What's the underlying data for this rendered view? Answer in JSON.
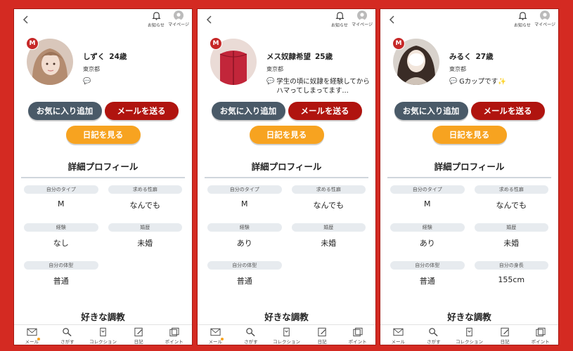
{
  "nav": {
    "notice_label": "お知らせ",
    "mypage_label": "マイページ"
  },
  "buttons": {
    "favorite": "お気に入り追加",
    "mail": "メールを送る",
    "diary": "日記を見る"
  },
  "sections": {
    "detail": "詳細プロフィール",
    "favorite_training": "好きな調教"
  },
  "tabs": {
    "mail": "メール",
    "search": "さがす",
    "collection": "コレクション",
    "diary": "日記",
    "points": "ポイント"
  },
  "badge": "M",
  "profiles": [
    {
      "name": "しずく",
      "age": "24歳",
      "area": "東京都",
      "message": "",
      "fields": [
        {
          "label": "自分のタイプ",
          "value": "M"
        },
        {
          "label": "求める性癖",
          "value": "なんでも"
        },
        {
          "label": "経験",
          "value": "なし"
        },
        {
          "label": "婚歴",
          "value": "未婚"
        },
        {
          "label": "自分の体型",
          "value": "普通"
        }
      ]
    },
    {
      "name": "メス奴隷希望",
      "age": "25歳",
      "area": "東京都",
      "message": "学生の頃に奴隷を経験してからハマってしまってます…",
      "fields": [
        {
          "label": "自分のタイプ",
          "value": "M"
        },
        {
          "label": "求める性癖",
          "value": "なんでも"
        },
        {
          "label": "経験",
          "value": "あり"
        },
        {
          "label": "婚歴",
          "value": "未婚"
        },
        {
          "label": "自分の体型",
          "value": "普通"
        }
      ]
    },
    {
      "name": "みるく",
      "age": "27歳",
      "area": "東京都",
      "message": "Gカップです✨",
      "fields": [
        {
          "label": "自分のタイプ",
          "value": "M"
        },
        {
          "label": "求める性癖",
          "value": "なんでも"
        },
        {
          "label": "経験",
          "value": "あり"
        },
        {
          "label": "婚歴",
          "value": "未婚"
        },
        {
          "label": "自分の体型",
          "value": "普通"
        },
        {
          "label": "自分の身長",
          "value": "155cm"
        }
      ]
    }
  ],
  "colors": {
    "background": "#d42a22",
    "favorite_button": "#4a5a68",
    "mail_button": "#b0140f",
    "diary_button": "#f7a320",
    "badge": "#c62828"
  }
}
